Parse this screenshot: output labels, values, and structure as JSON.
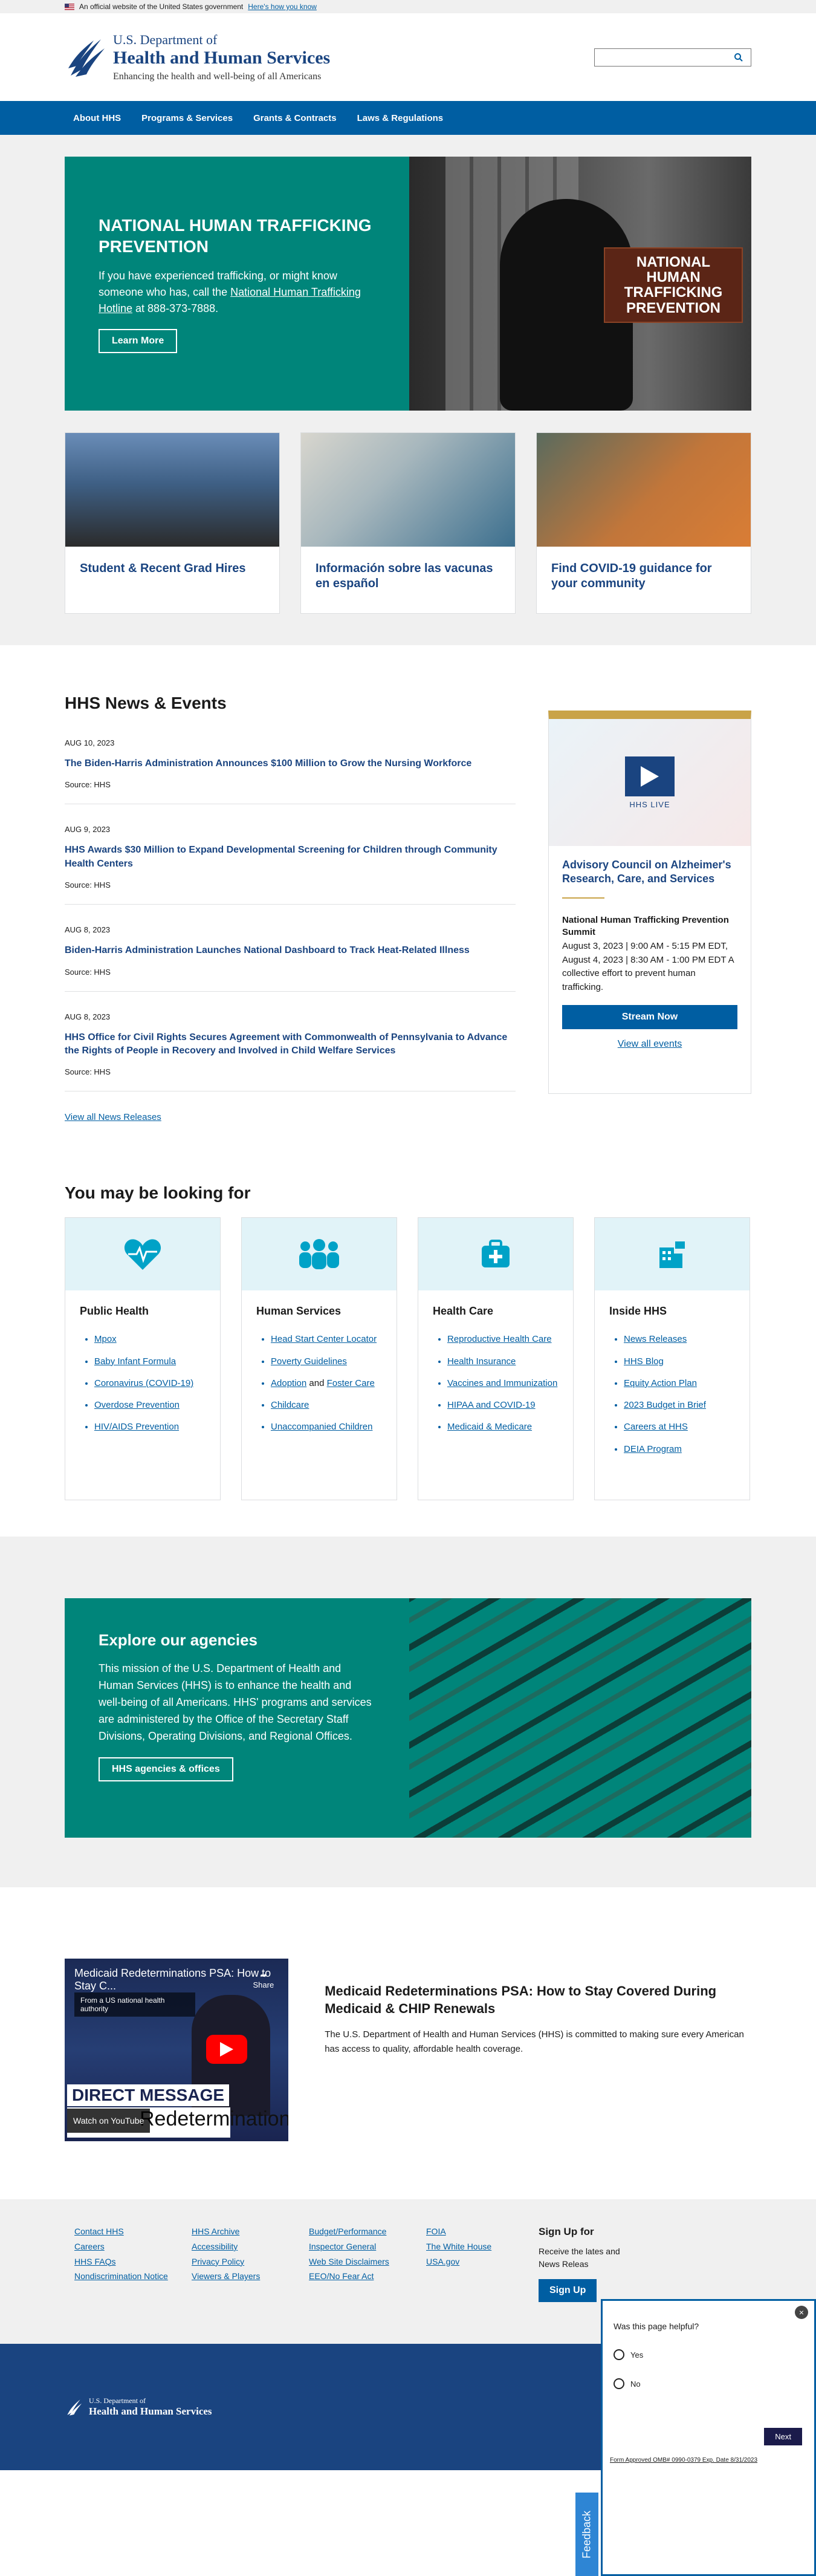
{
  "gov_banner": {
    "text": "An official website of the United States government",
    "link": "Here's how you know"
  },
  "header": {
    "dept_line1": "U.S. Department of",
    "dept_line2": "Health and Human Services",
    "tagline": "Enhancing the health and well-being of all Americans",
    "search_placeholder": ""
  },
  "nav": {
    "items": [
      "About HHS",
      "Programs & Services",
      "Grants & Contracts",
      "Laws & Regulations"
    ]
  },
  "hero": {
    "title": "NATIONAL HUMAN TRAFFICKING PREVENTION",
    "text_before": "If you have experienced trafficking, or might know someone who has, call the ",
    "link": "National Human Trafficking Hotline",
    "text_after": " at 888-373-7888.",
    "button": "Learn More",
    "badge_lines": [
      "NATIONAL HUMAN",
      "TRAFFICKING",
      "PREVENTION"
    ]
  },
  "cards": [
    {
      "title": "Student & Recent Grad Hires"
    },
    {
      "title": "Información sobre las vacunas en español"
    },
    {
      "title": "Find COVID-19 guidance for your community"
    }
  ],
  "news": {
    "heading": "HHS News & Events",
    "items": [
      {
        "date": "AUG 10, 2023",
        "title": "The Biden-Harris Administration Announces $100 Million to Grow the Nursing Workforce",
        "source": "Source: HHS"
      },
      {
        "date": "AUG 9, 2023",
        "title": "HHS Awards $30 Million to Expand Developmental Screening for Children through Community Health Centers",
        "source": "Source: HHS"
      },
      {
        "date": "AUG 8, 2023",
        "title": "Biden-Harris Administration Launches National Dashboard to Track Heat-Related Illness",
        "source": "Source: HHS"
      },
      {
        "date": "AUG 8, 2023",
        "title": "HHS Office for Civil Rights Secures Agreement with Commonwealth of Pennsylvania to Advance the Rights of People in Recovery and Involved in Child Welfare Services",
        "source": "Source: HHS"
      }
    ],
    "view_all": "View all News Releases"
  },
  "live": {
    "badge": "HHS LIVE",
    "title": "Advisory Council on Alzheimer's Research, Care, and Services",
    "event": "National Human Trafficking Prevention Summit",
    "details": "August 3, 2023 | 9:00 AM - 5:15 PM EDT, August 4, 2023 | 8:30 AM - 1:00 PM EDT A collective effort to prevent human trafficking.",
    "button": "Stream Now",
    "more": "View all events"
  },
  "looking": {
    "heading": "You may be looking for",
    "columns": [
      {
        "title": "Public Health",
        "icon": "heart-pulse-icon",
        "links": [
          "Mpox",
          "Baby Infant Formula",
          "Coronavirus (COVID-19)",
          "Overdose Prevention",
          "HIV/AIDS Prevention"
        ]
      },
      {
        "title": "Human Services",
        "icon": "people-icon",
        "links": [
          "Head Start Center Locator",
          "Poverty Guidelines",
          "Adoption",
          "Childcare",
          "Unaccompanied Children"
        ],
        "foster_and": "and",
        "foster": "Foster Care"
      },
      {
        "title": "Health Care",
        "icon": "medical-kit-icon",
        "links": [
          "Reproductive Health Care",
          "Health Insurance",
          "Vaccines and Immunization",
          "HIPAA and COVID-19",
          "Medicaid & Medicare"
        ]
      },
      {
        "title": "Inside HHS",
        "icon": "building-icon",
        "links": [
          "News Releases",
          "HHS Blog",
          "Equity Action Plan",
          "2023 Budget in Brief",
          "Careers at HHS",
          "DEIA Program"
        ]
      }
    ]
  },
  "agencies": {
    "title": "Explore our agencies",
    "text": "This mission of the U.S. Department of Health and Human Services (HHS) is to enhance the health and well-being of all Americans. HHS' programs and services are administered by the Office of the Secretary Staff Divisions, Operating Divisions, and Regional Offices.",
    "button": "HHS agencies & offices"
  },
  "video": {
    "player_title": "Medicaid Redeterminations PSA: How to Stay C...",
    "share": "Share",
    "info": "From a US national health authority",
    "direct": "DIRECT MESSAGE",
    "lower": "Redeterminations",
    "watch_on": "Watch on YouTube",
    "title": "Medicaid Redeterminations PSA: How to Stay Covered During Medicaid & CHIP Renewals",
    "text": "The U.S. Department of Health and Human Services (HHS) is committed to making sure every American has access to quality, affordable health coverage."
  },
  "footer": {
    "col1": [
      "Contact HHS",
      "Careers",
      "HHS FAQs",
      "Nondiscrimination Notice"
    ],
    "col2": [
      "HHS Archive",
      "Accessibility",
      "Privacy Policy",
      "Viewers & Players"
    ],
    "col3": [
      "Budget/Performance",
      "Inspector General",
      "Web Site Disclaimers",
      "EEO/No Fear Act"
    ],
    "col4": [
      "FOIA",
      "The White House",
      "USA.gov"
    ],
    "signup_title": "Sign Up for",
    "signup_text": "Receive the lates and News Releas",
    "signup_button": "Sign Up",
    "logo_line1": "U.S. Department of",
    "logo_line2": "Health and Human Services"
  },
  "survey": {
    "question": "Was this page helpful?",
    "yes": "Yes",
    "no": "No",
    "next": "Next",
    "omb": "Form Approved OMB# 0990-0379 Exp. Date 8/31/2023",
    "feedback": "Feedback"
  }
}
